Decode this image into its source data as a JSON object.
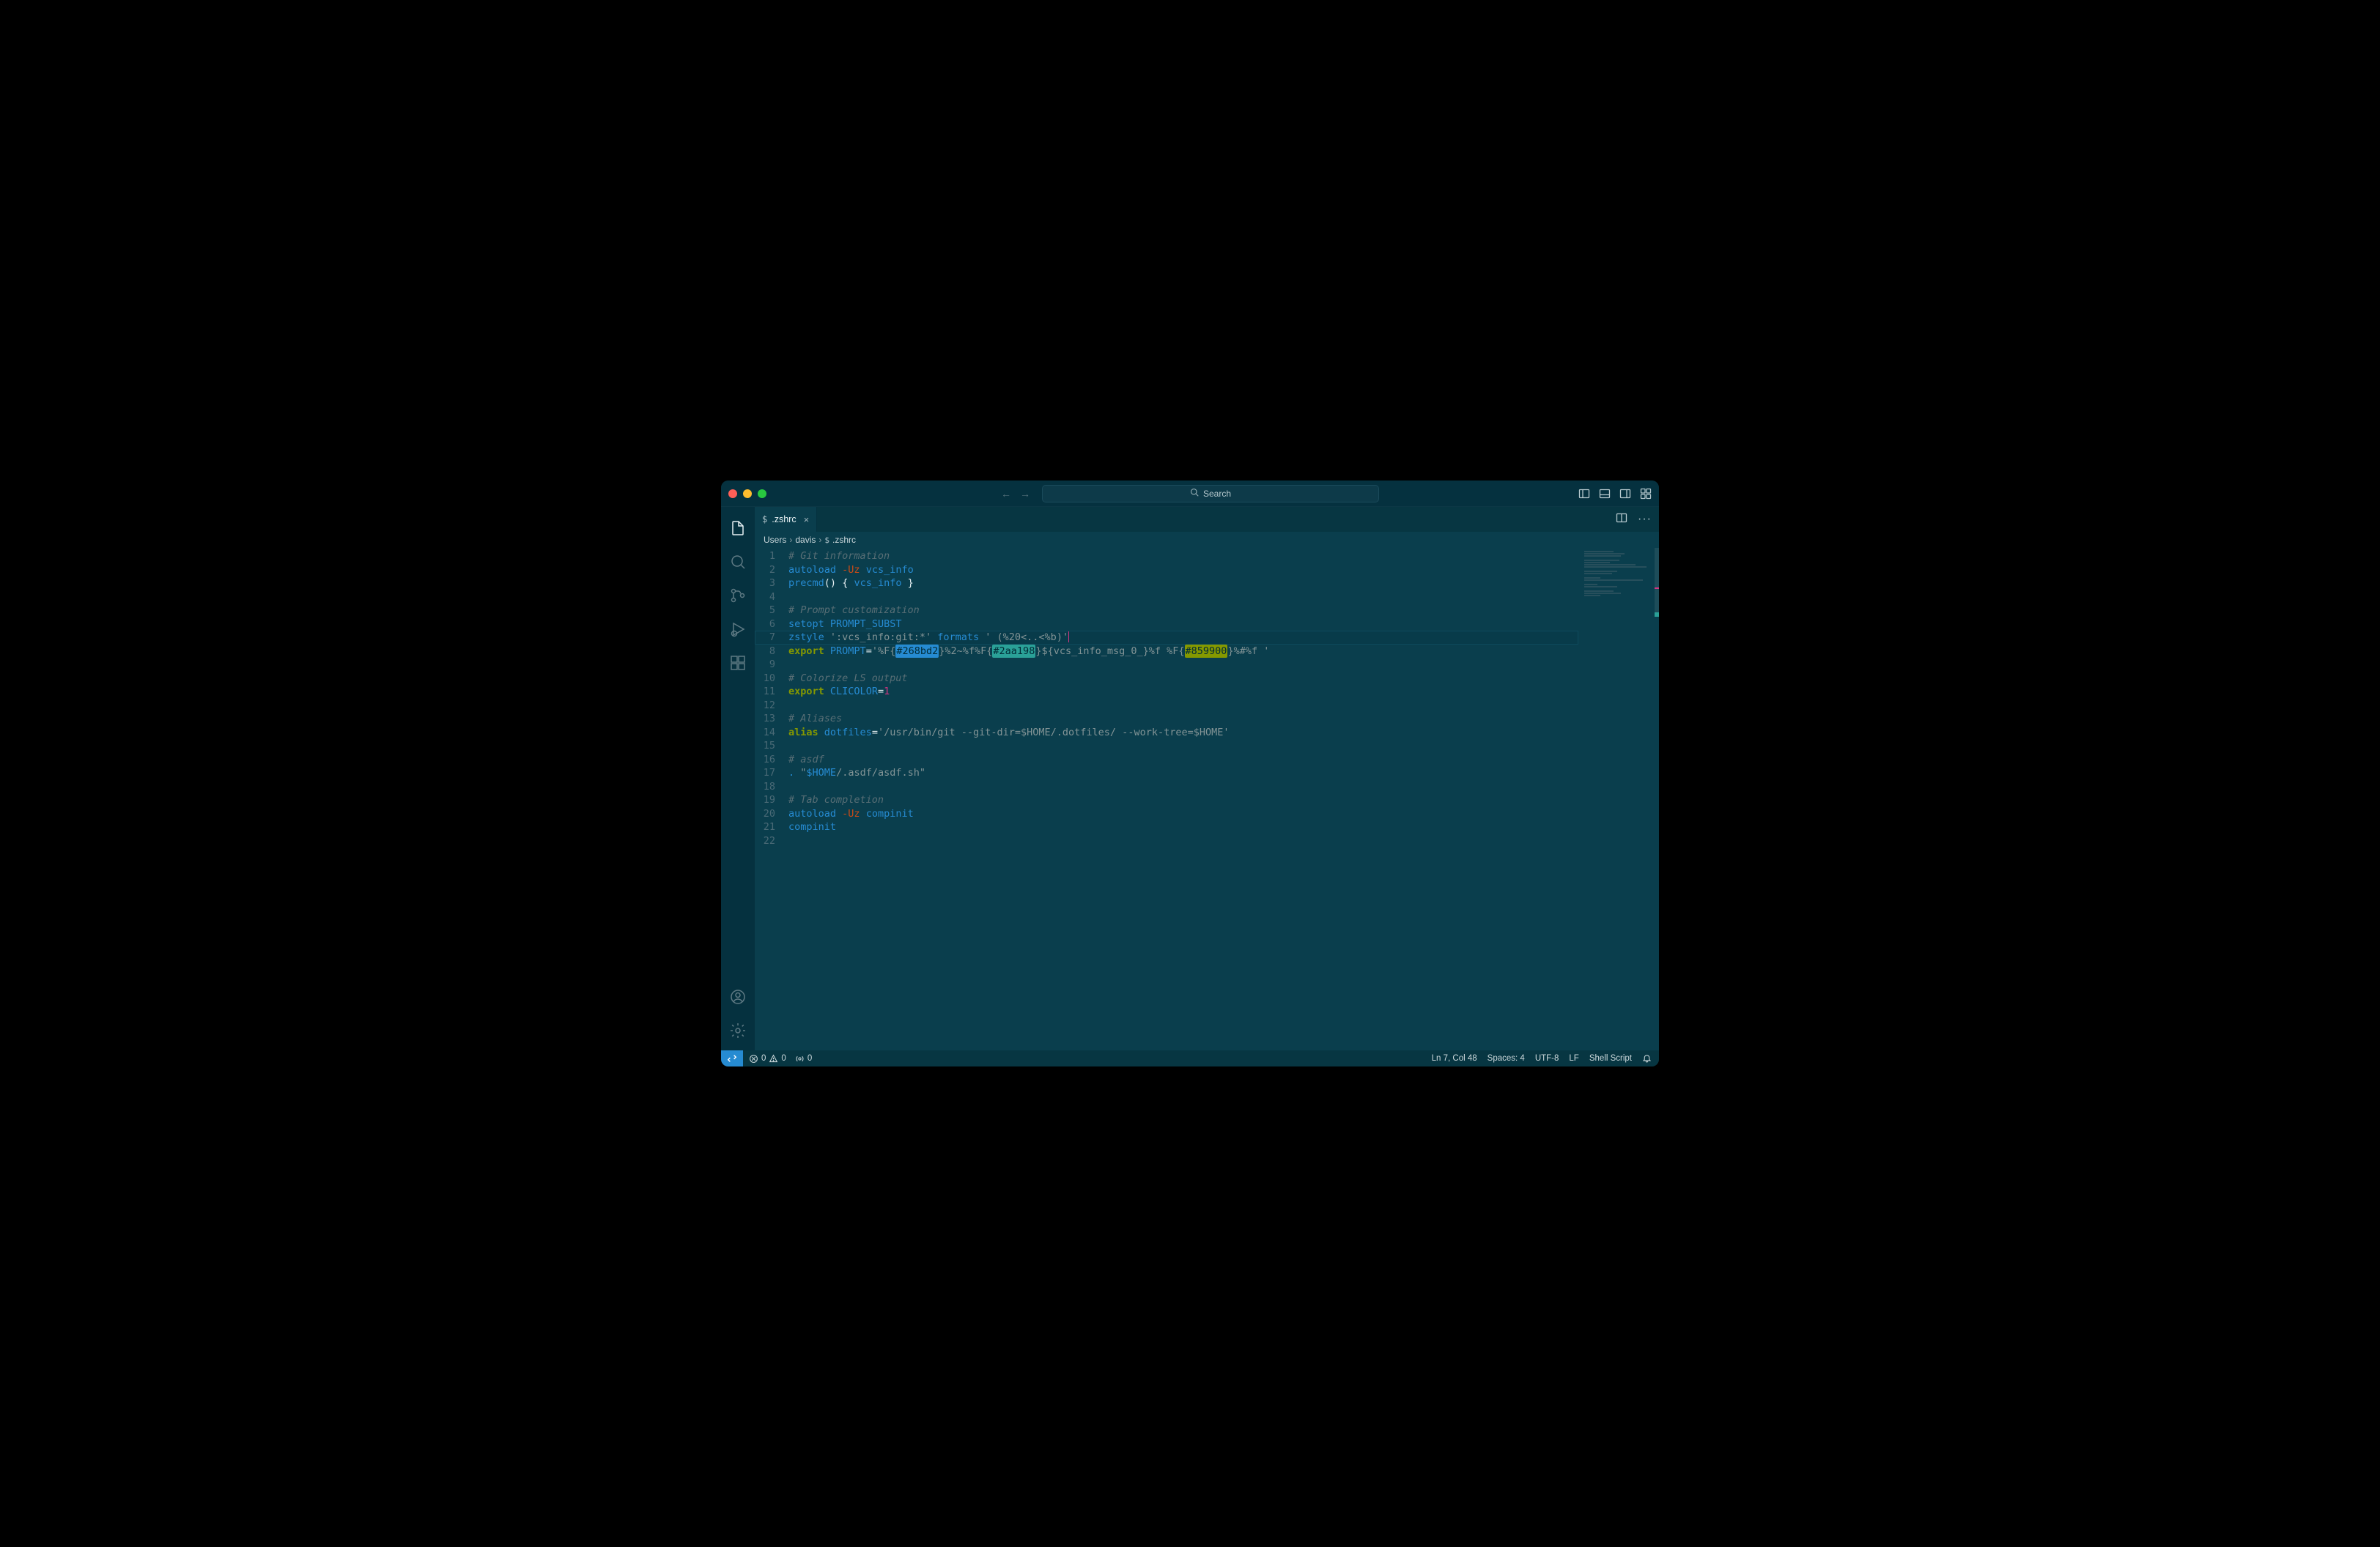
{
  "titlebar": {
    "search_placeholder": "Search"
  },
  "tab": {
    "icon": "$",
    "label": ".zshrc"
  },
  "breadcrumbs": {
    "seg1": "Users",
    "seg2": "davis",
    "icon": "$",
    "seg3": ".zshrc"
  },
  "gutter": [
    "1",
    "2",
    "3",
    "4",
    "5",
    "6",
    "7",
    "8",
    "9",
    "10",
    "11",
    "12",
    "13",
    "14",
    "15",
    "16",
    "17",
    "18",
    "19",
    "20",
    "21",
    "22"
  ],
  "code": {
    "l1_comment": "# Git information",
    "l2_cmd": "autoload",
    "l2_flag": "-Uz",
    "l2_arg": "vcs_info",
    "l3_cmd": "precmd",
    "l3_paren": "()",
    "l3_open": "{ ",
    "l3_body": "vcs_info",
    "l3_close": " }",
    "l5_comment": "# Prompt customization",
    "l6_cmd": "setopt",
    "l6_arg": "PROMPT_SUBST",
    "l7_cmd": "zstyle",
    "l7_s1": "':vcs_info:git:*'",
    "l7_arg": "formats",
    "l7_s2": "' (%20<..<%b)'",
    "l8_kw": "export",
    "l8_var": "PROMPT",
    "l8_eq": "=",
    "l8_p1": "'%F{",
    "l8_chip1": "#268bd2",
    "l8_p2": "}%2~%f%F{",
    "l8_chip2": "#2aa198",
    "l8_p3": "}${vcs_info_msg_0_}%f %F{",
    "l8_chip3": "#859900",
    "l8_p4": "}%#%f '",
    "l10_comment": "# Colorize LS output",
    "l11_kw": "export",
    "l11_var": "CLICOLOR",
    "l11_eq": "=",
    "l11_val": "1",
    "l13_comment": "# Aliases",
    "l14_kw": "alias",
    "l14_var": "dotfiles",
    "l14_eq": "=",
    "l14_str": "'/usr/bin/git --git-dir=$HOME/.dotfiles/ --work-tree=$HOME'",
    "l16_comment": "# asdf",
    "l17_dot": ".",
    "l17_q": "\"",
    "l17_home": "$HOME",
    "l17_rest": "/.asdf/asdf.sh",
    "l17_q2": "\"",
    "l19_comment": "# Tab completion",
    "l20_cmd": "autoload",
    "l20_flag": "-Uz",
    "l20_arg": "compinit",
    "l21_cmd": "compinit"
  },
  "status": {
    "errors": "0",
    "warnings": "0",
    "ports": "0",
    "cursor": "Ln 7, Col 48",
    "spaces": "Spaces: 4",
    "encoding": "UTF-8",
    "eol": "LF",
    "language": "Shell Script"
  }
}
